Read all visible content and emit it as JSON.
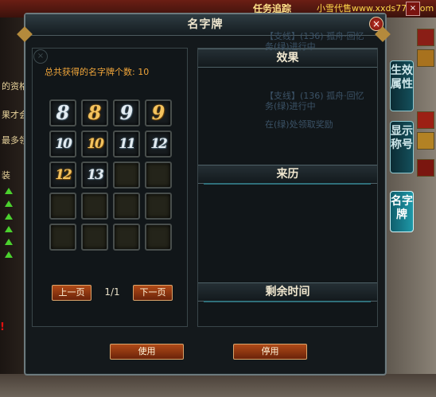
{
  "background": {
    "quest_label": "任务追踪",
    "watermark": "小雪代售www.xxds777.com",
    "close_glyph": "×",
    "left_texts": [
      "的资格",
      "果才会",
      "最多领",
      "装"
    ],
    "left_red_mark": "!",
    "side_tabs": [
      {
        "label": "生效属性",
        "active": false
      },
      {
        "label": "显示称号",
        "active": false
      },
      {
        "label": "名字牌",
        "active": true
      }
    ],
    "bleed_texts": [
      "【支线】(136) 孤舟·回忆",
      "务(绿)进行中",
      "【支线】(136) 孤舟·回忆",
      "务(绿)进行中",
      "在(绿)处领取奖励"
    ]
  },
  "window": {
    "title": "名字牌",
    "close_glyph": "×"
  },
  "name_plate_panel": {
    "count_label": "总共获得的名字牌个数: 10",
    "count": 10,
    "slots": [
      {
        "glyph": "8",
        "style": "silver"
      },
      {
        "glyph": "8",
        "style": "gold"
      },
      {
        "glyph": "9",
        "style": "silver"
      },
      {
        "glyph": "9",
        "style": "gold"
      },
      {
        "glyph": "10",
        "style": "silver"
      },
      {
        "glyph": "10",
        "style": "gold"
      },
      {
        "glyph": "11",
        "style": "silver"
      },
      {
        "glyph": "12",
        "style": "silver"
      },
      {
        "glyph": "12",
        "style": "gold"
      },
      {
        "glyph": "13",
        "style": "silver"
      },
      {
        "glyph": "",
        "style": "empty"
      },
      {
        "glyph": "",
        "style": "empty"
      },
      {
        "glyph": "",
        "style": "empty"
      },
      {
        "glyph": "",
        "style": "empty"
      },
      {
        "glyph": "",
        "style": "empty"
      },
      {
        "glyph": "",
        "style": "empty"
      },
      {
        "glyph": "",
        "style": "empty"
      },
      {
        "glyph": "",
        "style": "empty"
      },
      {
        "glyph": "",
        "style": "empty"
      },
      {
        "glyph": "",
        "style": "empty"
      }
    ],
    "prev_page": "上一页",
    "page_indicator": "1/1",
    "next_page": "下一页"
  },
  "details": {
    "effect_header": "效果",
    "source_header": "来历",
    "remaining_time_header": "剩余时间"
  },
  "actions": {
    "use_button": "使用",
    "disable_button": "停用"
  },
  "colors": {
    "accent_orange": "#f0a53a",
    "button_fill": "#b04a17",
    "teal_tab": "#1e98a8"
  }
}
